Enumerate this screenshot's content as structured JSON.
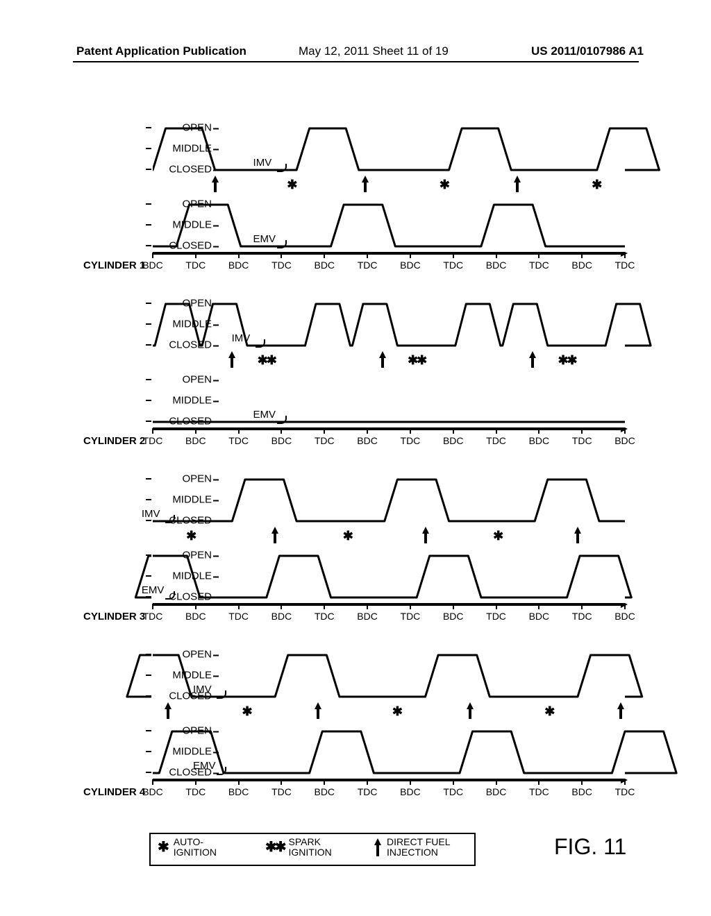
{
  "header": {
    "left": "Patent Application Publication",
    "mid": "May 12, 2011  Sheet 11 of 19",
    "right": "US 2011/0107986 A1"
  },
  "figure_label": "FIG. 11",
  "y_levels": [
    "OPEN",
    "MIDDLE",
    "CLOSED"
  ],
  "valve_labels": {
    "imv": "IMV",
    "emv": "EMV"
  },
  "x_labels": {
    "bdc": "BDC",
    "tdc": "TDC"
  },
  "legend": {
    "auto": "AUTO-\nIGNITION",
    "spark": "SPARK\nIGNITION",
    "inj": "DIRECT FUEL\nINJECTION"
  },
  "chart_data": {
    "type": "line",
    "note": "Valve lift vs crank position timing diagrams for 4 cylinders. x in units of half-revolutions (each step = one BDC/TDC alternation). y: 0=CLOSED, 0.5=MIDDLE, 1=OPEN.",
    "x_range": [
      0,
      11
    ],
    "y_range": [
      0,
      1
    ],
    "cylinders": [
      {
        "name": "CYLINDER 1",
        "x_start_label": "BDC",
        "imv_label_x": 3.05,
        "emv_label_x": 3.05,
        "imv_pulses_start": [
          0.0,
          3.35,
          6.9,
          10.35
        ],
        "imv_pulse_width_top": 0.85,
        "imv_pulse_rise": 0.3,
        "emv_pulses_start": [
          0.55,
          4.15,
          7.65
        ],
        "emv_pulse_width_top": 0.9,
        "emv_pulse_rise": 0.3,
        "events": [
          {
            "x": 1.45,
            "type": "inj"
          },
          {
            "x": 3.25,
            "type": "auto"
          },
          {
            "x": 4.95,
            "type": "inj"
          },
          {
            "x": 6.8,
            "type": "auto"
          },
          {
            "x": 8.5,
            "type": "inj"
          },
          {
            "x": 10.35,
            "type": "auto"
          }
        ]
      },
      {
        "name": "CYLINDER 2",
        "x_start_label": "TDC",
        "imv_label_x": 2.55,
        "emv_label_x": 3.05,
        "imv_pulses_start": [
          0.05,
          1.15,
          3.55,
          4.65,
          7.05,
          8.15,
          10.55
        ],
        "imv_pulse_width_top": 0.55,
        "imv_pulse_rise": 0.25,
        "emv_pulses_start": [],
        "emv_baseline_only": true,
        "events": [
          {
            "x": 1.85,
            "type": "inj"
          },
          {
            "x": 2.65,
            "type": "spark"
          },
          {
            "x": 5.35,
            "type": "inj"
          },
          {
            "x": 6.15,
            "type": "spark"
          },
          {
            "x": 8.85,
            "type": "inj"
          },
          {
            "x": 9.65,
            "type": "spark"
          }
        ]
      },
      {
        "name": "CYLINDER 3",
        "x_start_label": "TDC",
        "imv_label_x": 0.45,
        "emv_label_x": 0.45,
        "imv_pulses_start": [
          1.85,
          5.4,
          8.9
        ],
        "imv_pulse_width_top": 0.9,
        "imv_pulse_rise": 0.3,
        "emv_pulses_start": [
          -0.4,
          2.65,
          6.15,
          9.65
        ],
        "emv_pulse_width_top": 0.9,
        "emv_pulse_rise": 0.3,
        "events": [
          {
            "x": 0.9,
            "type": "auto"
          },
          {
            "x": 2.85,
            "type": "inj"
          },
          {
            "x": 4.55,
            "type": "auto"
          },
          {
            "x": 6.35,
            "type": "inj"
          },
          {
            "x": 8.05,
            "type": "auto"
          },
          {
            "x": 9.9,
            "type": "inj"
          }
        ]
      },
      {
        "name": "CYLINDER 4",
        "x_start_label": "BDC",
        "imv_label_x": 1.65,
        "emv_label_x": 1.65,
        "imv_pulses_start": [
          -0.6,
          2.85,
          6.35,
          9.9
        ],
        "imv_pulse_width_top": 0.9,
        "imv_pulse_rise": 0.3,
        "emv_pulses_start": [
          0.15,
          3.65,
          7.15,
          10.7
        ],
        "emv_pulse_width_top": 0.9,
        "emv_pulse_rise": 0.3,
        "events": [
          {
            "x": 0.35,
            "type": "inj"
          },
          {
            "x": 2.2,
            "type": "auto"
          },
          {
            "x": 3.85,
            "type": "inj"
          },
          {
            "x": 5.7,
            "type": "auto"
          },
          {
            "x": 7.4,
            "type": "inj"
          },
          {
            "x": 9.25,
            "type": "auto"
          },
          {
            "x": 10.9,
            "type": "inj"
          }
        ]
      }
    ]
  }
}
